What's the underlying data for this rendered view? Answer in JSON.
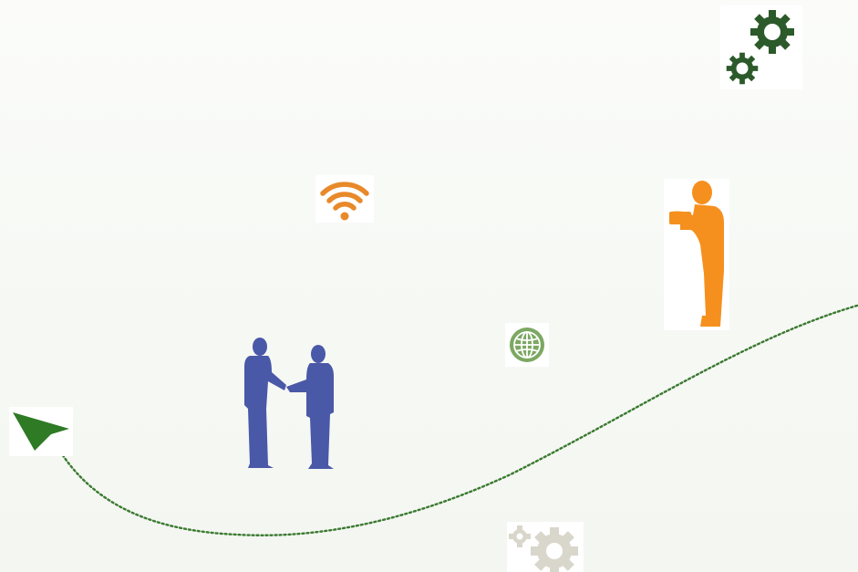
{
  "colors": {
    "gear_dark": "#2c5a2a",
    "gear_light": "#d9d6cc",
    "wifi": "#e8892a",
    "person_orange": "#f5901e",
    "handshake": "#4a58a8",
    "globe": "#7ca862",
    "arrow": "#2e7a25",
    "path": "#3a7a30"
  },
  "icons": [
    "gears-dark-icon",
    "wifi-icon",
    "person-reading-icon",
    "globe-icon",
    "handshake-icon",
    "arrow-cursor-icon",
    "gears-light-icon",
    "dotted-path"
  ]
}
